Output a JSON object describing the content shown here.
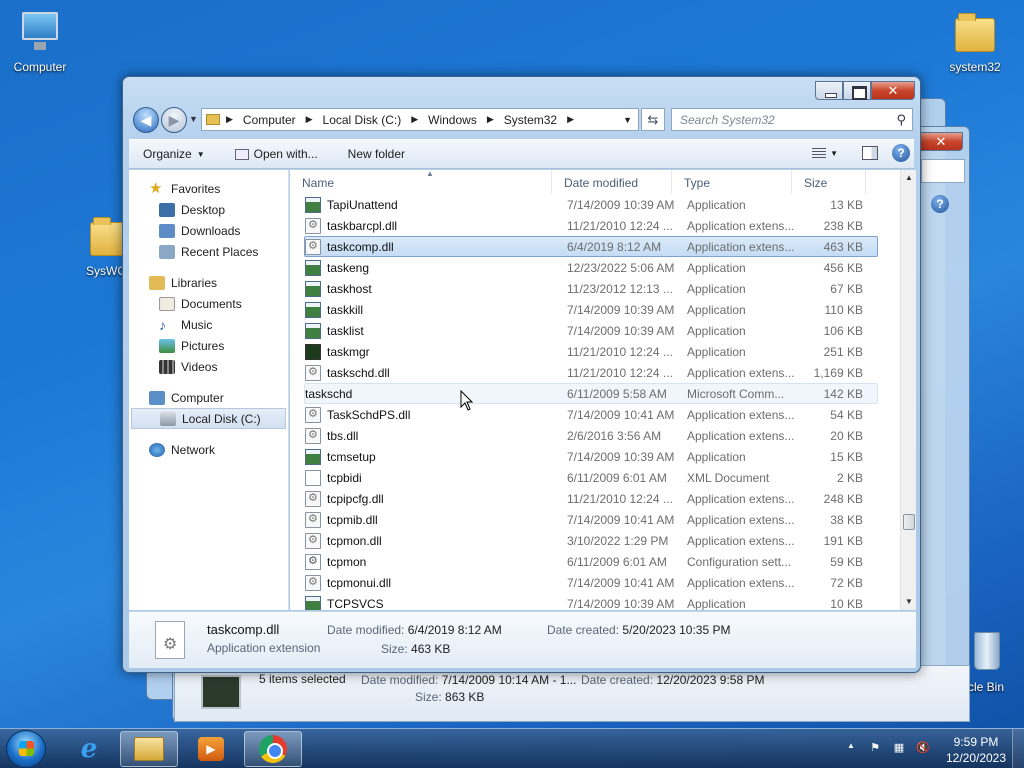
{
  "desktop": {
    "icons": [
      {
        "label": "Computer"
      },
      {
        "label": "system32"
      },
      {
        "label": "SysWO"
      },
      {
        "label": "cle Bin"
      }
    ]
  },
  "window": {
    "address": [
      "Computer",
      "Local Disk (C:)",
      "Windows",
      "System32"
    ],
    "search_placeholder": "Search System32",
    "toolbar": {
      "organize": "Organize",
      "open_with": "Open with...",
      "new_folder": "New folder"
    },
    "nav": {
      "favorites": "Favorites",
      "desktop": "Desktop",
      "downloads": "Downloads",
      "recent": "Recent Places",
      "libraries": "Libraries",
      "documents": "Documents",
      "music": "Music",
      "pictures": "Pictures",
      "videos": "Videos",
      "computer": "Computer",
      "localdisk": "Local Disk (C:)",
      "network": "Network"
    },
    "columns": {
      "name": "Name",
      "date": "Date modified",
      "type": "Type",
      "size": "Size"
    },
    "files": [
      {
        "name": "TapiUnattend",
        "date": "7/14/2009 10:39 AM",
        "type": "Application",
        "size": "13 KB",
        "icon": "app"
      },
      {
        "name": "taskbarcpl.dll",
        "date": "11/21/2010 12:24 ...",
        "type": "Application extens...",
        "size": "238 KB",
        "icon": "dll"
      },
      {
        "name": "taskcomp.dll",
        "date": "6/4/2019 8:12 AM",
        "type": "Application extens...",
        "size": "463 KB",
        "icon": "dll"
      },
      {
        "name": "taskeng",
        "date": "12/23/2022 5:06 AM",
        "type": "Application",
        "size": "456 KB",
        "icon": "app"
      },
      {
        "name": "taskhost",
        "date": "11/23/2012 12:13 ...",
        "type": "Application",
        "size": "67 KB",
        "icon": "app"
      },
      {
        "name": "taskkill",
        "date": "7/14/2009 10:39 AM",
        "type": "Application",
        "size": "110 KB",
        "icon": "app"
      },
      {
        "name": "tasklist",
        "date": "7/14/2009 10:39 AM",
        "type": "Application",
        "size": "106 KB",
        "icon": "app"
      },
      {
        "name": "taskmgr",
        "date": "11/21/2010 12:24 ...",
        "type": "Application",
        "size": "251 KB",
        "icon": "mgr"
      },
      {
        "name": "taskschd.dll",
        "date": "11/21/2010 12:24 ...",
        "type": "Application extens...",
        "size": "1,169 KB",
        "icon": "dll"
      },
      {
        "name": "taskschd",
        "date": "6/11/2009 5:58 AM",
        "type": "Microsoft Comm...",
        "size": "142 KB",
        "icon": "clock"
      },
      {
        "name": "TaskSchdPS.dll",
        "date": "7/14/2009 10:41 AM",
        "type": "Application extens...",
        "size": "54 KB",
        "icon": "dll"
      },
      {
        "name": "tbs.dll",
        "date": "2/6/2016 3:56 AM",
        "type": "Application extens...",
        "size": "20 KB",
        "icon": "dll"
      },
      {
        "name": "tcmsetup",
        "date": "7/14/2009 10:39 AM",
        "type": "Application",
        "size": "15 KB",
        "icon": "app"
      },
      {
        "name": "tcpbidi",
        "date": "6/11/2009 6:01 AM",
        "type": "XML Document",
        "size": "2 KB",
        "icon": "xml"
      },
      {
        "name": "tcpipcfg.dll",
        "date": "11/21/2010 12:24 ...",
        "type": "Application extens...",
        "size": "248 KB",
        "icon": "dll"
      },
      {
        "name": "tcpmib.dll",
        "date": "7/14/2009 10:41 AM",
        "type": "Application extens...",
        "size": "38 KB",
        "icon": "dll"
      },
      {
        "name": "tcpmon.dll",
        "date": "3/10/2022 1:29 PM",
        "type": "Application extens...",
        "size": "191 KB",
        "icon": "dll"
      },
      {
        "name": "tcpmon",
        "date": "6/11/2009 6:01 AM",
        "type": "Configuration sett...",
        "size": "59 KB",
        "icon": "cfg"
      },
      {
        "name": "tcpmonui.dll",
        "date": "7/14/2009 10:41 AM",
        "type": "Application extens...",
        "size": "72 KB",
        "icon": "dll"
      },
      {
        "name": "TCPSVCS",
        "date": "7/14/2009 10:39 AM",
        "type": "Application",
        "size": "10 KB",
        "icon": "app"
      }
    ],
    "selected_index": 2,
    "hover_index": 9,
    "details": {
      "name": "taskcomp.dll",
      "type": "Application extension",
      "modified_label": "Date modified:",
      "modified": "6/4/2019 8:12 AM",
      "created_label": "Date created:",
      "created": "5/20/2023 10:35 PM",
      "size_label": "Size:",
      "size": "463 KB"
    }
  },
  "back_window": {
    "summary": "5 items selected",
    "modified_label": "Date modified:",
    "modified": "7/14/2009 10:14 AM - 1...",
    "created_label": "Date created:",
    "created": "12/20/2023 9:58 PM",
    "size_label": "Size:",
    "size": "863 KB"
  },
  "taskbar": {
    "time": "9:59 PM",
    "date": "12/20/2023",
    "wmp_glyph": "▶",
    "tray_expand": "▲",
    "tray_flag": "⚑",
    "tray_network": "▦",
    "tray_volume": "🔇"
  }
}
